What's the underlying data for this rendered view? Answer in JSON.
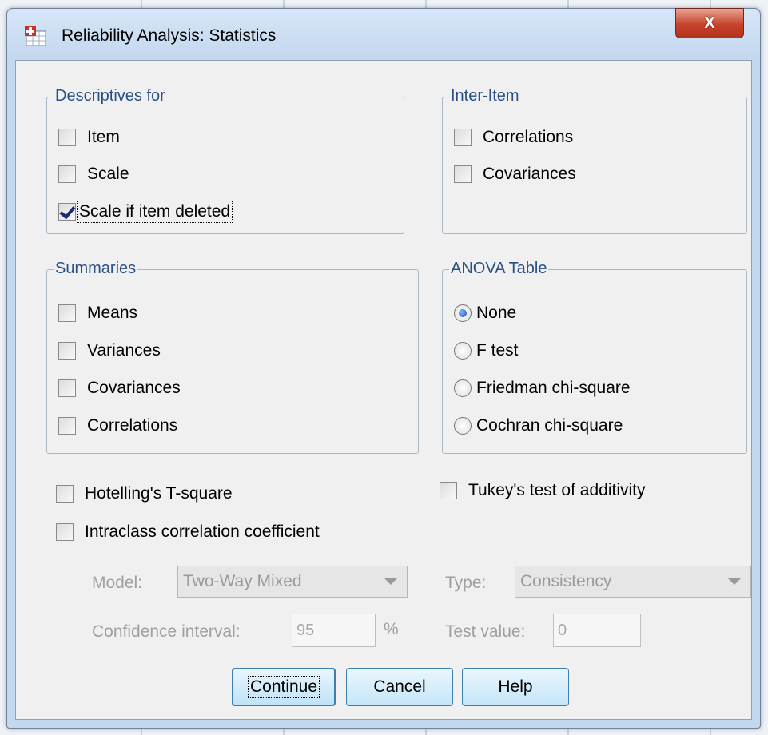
{
  "window": {
    "title": "Reliability Analysis: Statistics",
    "close_label": "X"
  },
  "descriptives": {
    "legend": "Descriptives for",
    "items": [
      {
        "label": "Item",
        "checked": false
      },
      {
        "label": "Scale",
        "checked": false
      },
      {
        "label": "Scale if item deleted",
        "checked": true
      }
    ]
  },
  "inter_item": {
    "legend": "Inter-Item",
    "items": [
      {
        "label": "Correlations",
        "checked": false
      },
      {
        "label": "Covariances",
        "checked": false
      }
    ]
  },
  "summaries": {
    "legend": "Summaries",
    "items": [
      {
        "label": "Means",
        "checked": false
      },
      {
        "label": "Variances",
        "checked": false
      },
      {
        "label": "Covariances",
        "checked": false
      },
      {
        "label": "Correlations",
        "checked": false
      }
    ]
  },
  "anova": {
    "legend": "ANOVA Table",
    "options": [
      {
        "label": "None",
        "selected": true
      },
      {
        "label": "F test",
        "selected": false
      },
      {
        "label": "Friedman chi-square",
        "selected": false
      },
      {
        "label": "Cochran chi-square",
        "selected": false
      }
    ]
  },
  "extras": {
    "hotelling": "Hotelling's T-square",
    "tukey": "Tukey's test of additivity",
    "intraclass": "Intraclass correlation coefficient"
  },
  "icc": {
    "model_label": "Model:",
    "model_value": "Two-Way Mixed",
    "type_label": "Type:",
    "type_value": "Consistency",
    "ci_label": "Confidence interval:",
    "ci_value": "95",
    "ci_unit": "%",
    "test_label": "Test value:",
    "test_value": "0"
  },
  "buttons": {
    "continue": "Continue",
    "cancel": "Cancel",
    "help": "Help"
  }
}
